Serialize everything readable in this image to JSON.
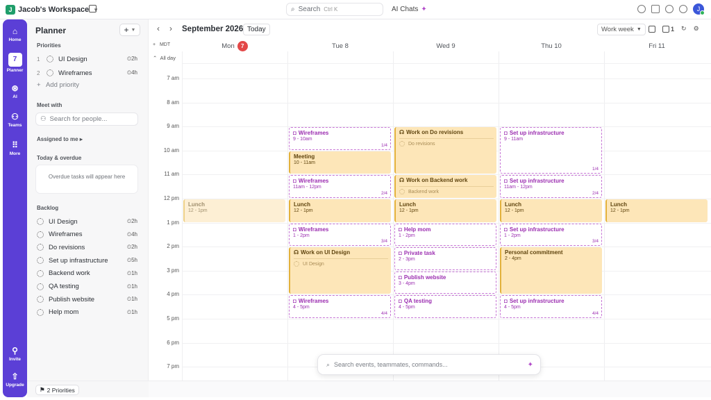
{
  "topbar": {
    "workspace": "Jacob's Workspace",
    "workspace_initial": "J",
    "search": "Search",
    "search_kbd": "Ctrl K",
    "ai_chats": "AI Chats",
    "avatar": "J"
  },
  "rail": {
    "home": "Home",
    "planner": "Planner",
    "planner_day": "7",
    "ai": "AI",
    "teams": "Teams",
    "more": "More",
    "invite": "Invite",
    "upgrade": "Upgrade"
  },
  "planner": {
    "title": "Planner",
    "priorities_label": "Priorities",
    "priorities": [
      {
        "n": "1",
        "name": "UI Design",
        "dur": "2h"
      },
      {
        "n": "2",
        "name": "Wireframes",
        "dur": "4h"
      }
    ],
    "add_priority": "Add priority",
    "meet_with": "Meet with",
    "search_people": "Search for people...",
    "assigned": "Assigned to me",
    "today_overdue": "Today & overdue",
    "overdue_msg": "Overdue tasks will appear here",
    "backlog_label": "Backlog",
    "backlog": [
      {
        "name": "UI Design",
        "dur": "2h"
      },
      {
        "name": "Wireframes",
        "dur": "4h"
      },
      {
        "name": "Do revisions",
        "dur": "2h"
      },
      {
        "name": "Set up infrastructure",
        "dur": "5h"
      },
      {
        "name": "Backend work",
        "dur": "1h"
      },
      {
        "name": "QA testing",
        "dur": "1h"
      },
      {
        "name": "Publish website",
        "dur": "1h"
      },
      {
        "name": "Help mom",
        "dur": "1h"
      }
    ],
    "footer": "2 Priorities"
  },
  "calendar": {
    "month": "September 2026",
    "today": "Today",
    "view": "Work week",
    "cal_count": "1",
    "tz": "MDT",
    "all_day": "All day",
    "days": [
      {
        "name": "Mon",
        "num": "7",
        "today": true
      },
      {
        "name": "Tue 8"
      },
      {
        "name": "Wed 9"
      },
      {
        "name": "Thu 10"
      },
      {
        "name": "Fri 11"
      }
    ],
    "hours": [
      "7 am",
      "8 am",
      "9 am",
      "10 am",
      "11 am",
      "12 pm",
      "1 pm",
      "2 pm",
      "3 pm",
      "4 pm",
      "5 pm",
      "6 pm",
      "7 pm"
    ],
    "events": [
      {
        "day": 0,
        "start": 12,
        "end": 13,
        "kind": "meet",
        "title": "Lunch",
        "time": "12 - 1pm",
        "faded": true
      },
      {
        "day": 1,
        "start": 9,
        "end": 10,
        "kind": "task",
        "title": "Wireframes",
        "time": "9 - 10am",
        "frac": "1/4"
      },
      {
        "day": 1,
        "start": 10,
        "end": 11,
        "kind": "meet",
        "title": "Meeting",
        "time": "10 - 11am"
      },
      {
        "day": 1,
        "start": 11,
        "end": 12,
        "kind": "task",
        "title": "Wireframes",
        "time": "11am - 12pm",
        "frac": "2/4"
      },
      {
        "day": 1,
        "start": 12,
        "end": 13,
        "kind": "meet",
        "title": "Lunch",
        "time": "12 - 1pm"
      },
      {
        "day": 1,
        "start": 13,
        "end": 14,
        "kind": "task",
        "title": "Wireframes",
        "time": "1 - 2pm",
        "frac": "3/4"
      },
      {
        "day": 1,
        "start": 14,
        "end": 16,
        "kind": "meet",
        "title": "Work on UI Design",
        "sub": "UI Design",
        "focus": true
      },
      {
        "day": 1,
        "start": 16,
        "end": 17,
        "kind": "task",
        "title": "Wireframes",
        "time": "4 - 5pm",
        "frac": "4/4"
      },
      {
        "day": 2,
        "start": 9,
        "end": 11,
        "kind": "meet",
        "title": "Work on Do revisions",
        "sub": "Do revisions",
        "focus": true
      },
      {
        "day": 2,
        "start": 11,
        "end": 12,
        "kind": "meet",
        "title": "Work on Backend work",
        "sub": "Backend work",
        "focus": true
      },
      {
        "day": 2,
        "start": 12,
        "end": 13,
        "kind": "meet",
        "title": "Lunch",
        "time": "12 - 1pm"
      },
      {
        "day": 2,
        "start": 13,
        "end": 14,
        "kind": "task",
        "title": "Help mom",
        "time": "1 - 2pm"
      },
      {
        "day": 2,
        "start": 14,
        "end": 15,
        "kind": "task",
        "title": "Private task",
        "time": "2 - 3pm"
      },
      {
        "day": 2,
        "start": 15,
        "end": 16,
        "kind": "task",
        "title": "Publish website",
        "time": "3 - 4pm"
      },
      {
        "day": 2,
        "start": 16,
        "end": 17,
        "kind": "task",
        "title": "QA testing",
        "time": "4 - 5pm"
      },
      {
        "day": 3,
        "start": 9,
        "end": 11,
        "kind": "task",
        "title": "Set up infrastructure",
        "time": "9 - 11am",
        "frac": "1/4"
      },
      {
        "day": 3,
        "start": 11,
        "end": 12,
        "kind": "task",
        "title": "Set up infrastructure",
        "time": "11am - 12pm",
        "frac": "2/4"
      },
      {
        "day": 3,
        "start": 12,
        "end": 13,
        "kind": "meet",
        "title": "Lunch",
        "time": "12 - 1pm"
      },
      {
        "day": 3,
        "start": 13,
        "end": 14,
        "kind": "task",
        "title": "Set up infrastructure",
        "time": "1 - 2pm",
        "frac": "3/4"
      },
      {
        "day": 3,
        "start": 14,
        "end": 16,
        "kind": "meet",
        "title": "Personal commitment",
        "time": "2 - 4pm"
      },
      {
        "day": 3,
        "start": 16,
        "end": 17,
        "kind": "task",
        "title": "Set up infrastructure",
        "time": "4 - 5pm",
        "frac": "4/4"
      },
      {
        "day": 4,
        "start": 12,
        "end": 13,
        "kind": "meet",
        "title": "Lunch",
        "time": "12 - 1pm"
      }
    ]
  },
  "command_bar": {
    "placeholder": "Search events, teammates, commands..."
  },
  "colors": {
    "rail": "#5b3fd6",
    "task": "#9b2db0",
    "meeting_bg": "#fde6b8",
    "today_badge": "#e34848"
  }
}
